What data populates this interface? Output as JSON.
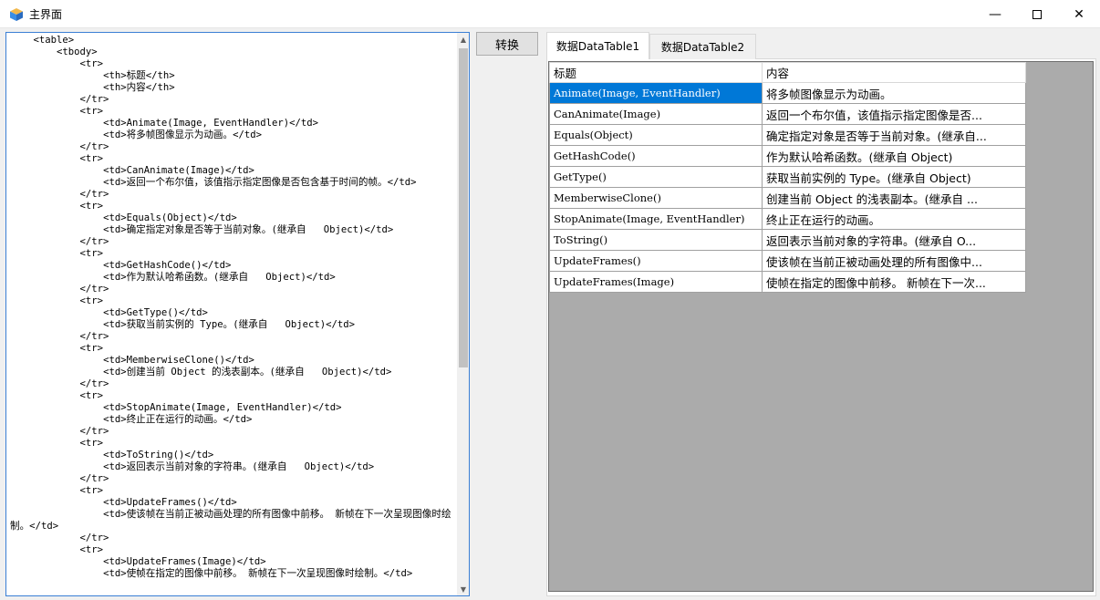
{
  "window": {
    "title": "主界面",
    "controls": {
      "minimize": "—",
      "close": "✕"
    }
  },
  "editor": {
    "content": "    <table>\n        <tbody>\n            <tr>\n                <th>标题</th>\n                <th>内容</th>\n            </tr>\n            <tr>\n                <td>Animate(Image, EventHandler)</td>\n                <td>将多帧图像显示为动画。</td>\n            </tr>\n            <tr>\n                <td>CanAnimate(Image)</td>\n                <td>返回一个布尔值，该值指示指定图像是否包含基于时间的帧。</td>\n            </tr>\n            <tr>\n                <td>Equals(Object)</td>\n                <td>确定指定对象是否等于当前对象。(继承自   Object)</td>\n            </tr>\n            <tr>\n                <td>GetHashCode()</td>\n                <td>作为默认哈希函数。(继承自   Object)</td>\n            </tr>\n            <tr>\n                <td>GetType()</td>\n                <td>获取当前实例的 Type。(继承自   Object)</td>\n            </tr>\n            <tr>\n                <td>MemberwiseClone()</td>\n                <td>创建当前 Object 的浅表副本。(继承自   Object)</td>\n            </tr>\n            <tr>\n                <td>StopAnimate(Image, EventHandler)</td>\n                <td>终止正在运行的动画。</td>\n            </tr>\n            <tr>\n                <td>ToString()</td>\n                <td>返回表示当前对象的字符串。(继承自   Object)</td>\n            </tr>\n            <tr>\n                <td>UpdateFrames()</td>\n                <td>使该帧在当前正被动画处理的所有图像中前移。 新帧在下一次呈现图像时绘制。</td>\n            </tr>\n            <tr>\n                <td>UpdateFrames(Image)</td>\n                <td>使帧在指定的图像中前移。 新帧在下一次呈现图像时绘制。</td>"
  },
  "convert_button": "转换",
  "tabs": [
    "数据DataTable1",
    "数据DataTable2"
  ],
  "grid": {
    "headers": [
      "标题",
      "内容"
    ],
    "rows": [
      [
        "Animate(Image, EventHandler)",
        "将多帧图像显示为动画。"
      ],
      [
        "CanAnimate(Image)",
        "返回一个布尔值，该值指示指定图像是否..."
      ],
      [
        "Equals(Object)",
        "确定指定对象是否等于当前对象。(继承自..."
      ],
      [
        "GetHashCode()",
        "作为默认哈希函数。(继承自   Object)"
      ],
      [
        "GetType()",
        "获取当前实例的 Type。(继承自   Object)"
      ],
      [
        "MemberwiseClone()",
        "创建当前 Object 的浅表副本。(继承自   ..."
      ],
      [
        "StopAnimate(Image, EventHandler)",
        "终止正在运行的动画。"
      ],
      [
        "ToString()",
        "返回表示当前对象的字符串。(继承自   O..."
      ],
      [
        "UpdateFrames()",
        "使该帧在当前正被动画处理的所有图像中..."
      ],
      [
        "UpdateFrames(Image)",
        "使帧在指定的图像中前移。 新帧在下一次..."
      ]
    ]
  },
  "colors": {
    "selection": "#0078d7",
    "grid_background": "#ababab",
    "focus_border": "#3a7fd5"
  },
  "icons": {
    "app": "app-icon",
    "scroll_up": "chevron-up-icon",
    "scroll_down": "chevron-down-icon"
  }
}
